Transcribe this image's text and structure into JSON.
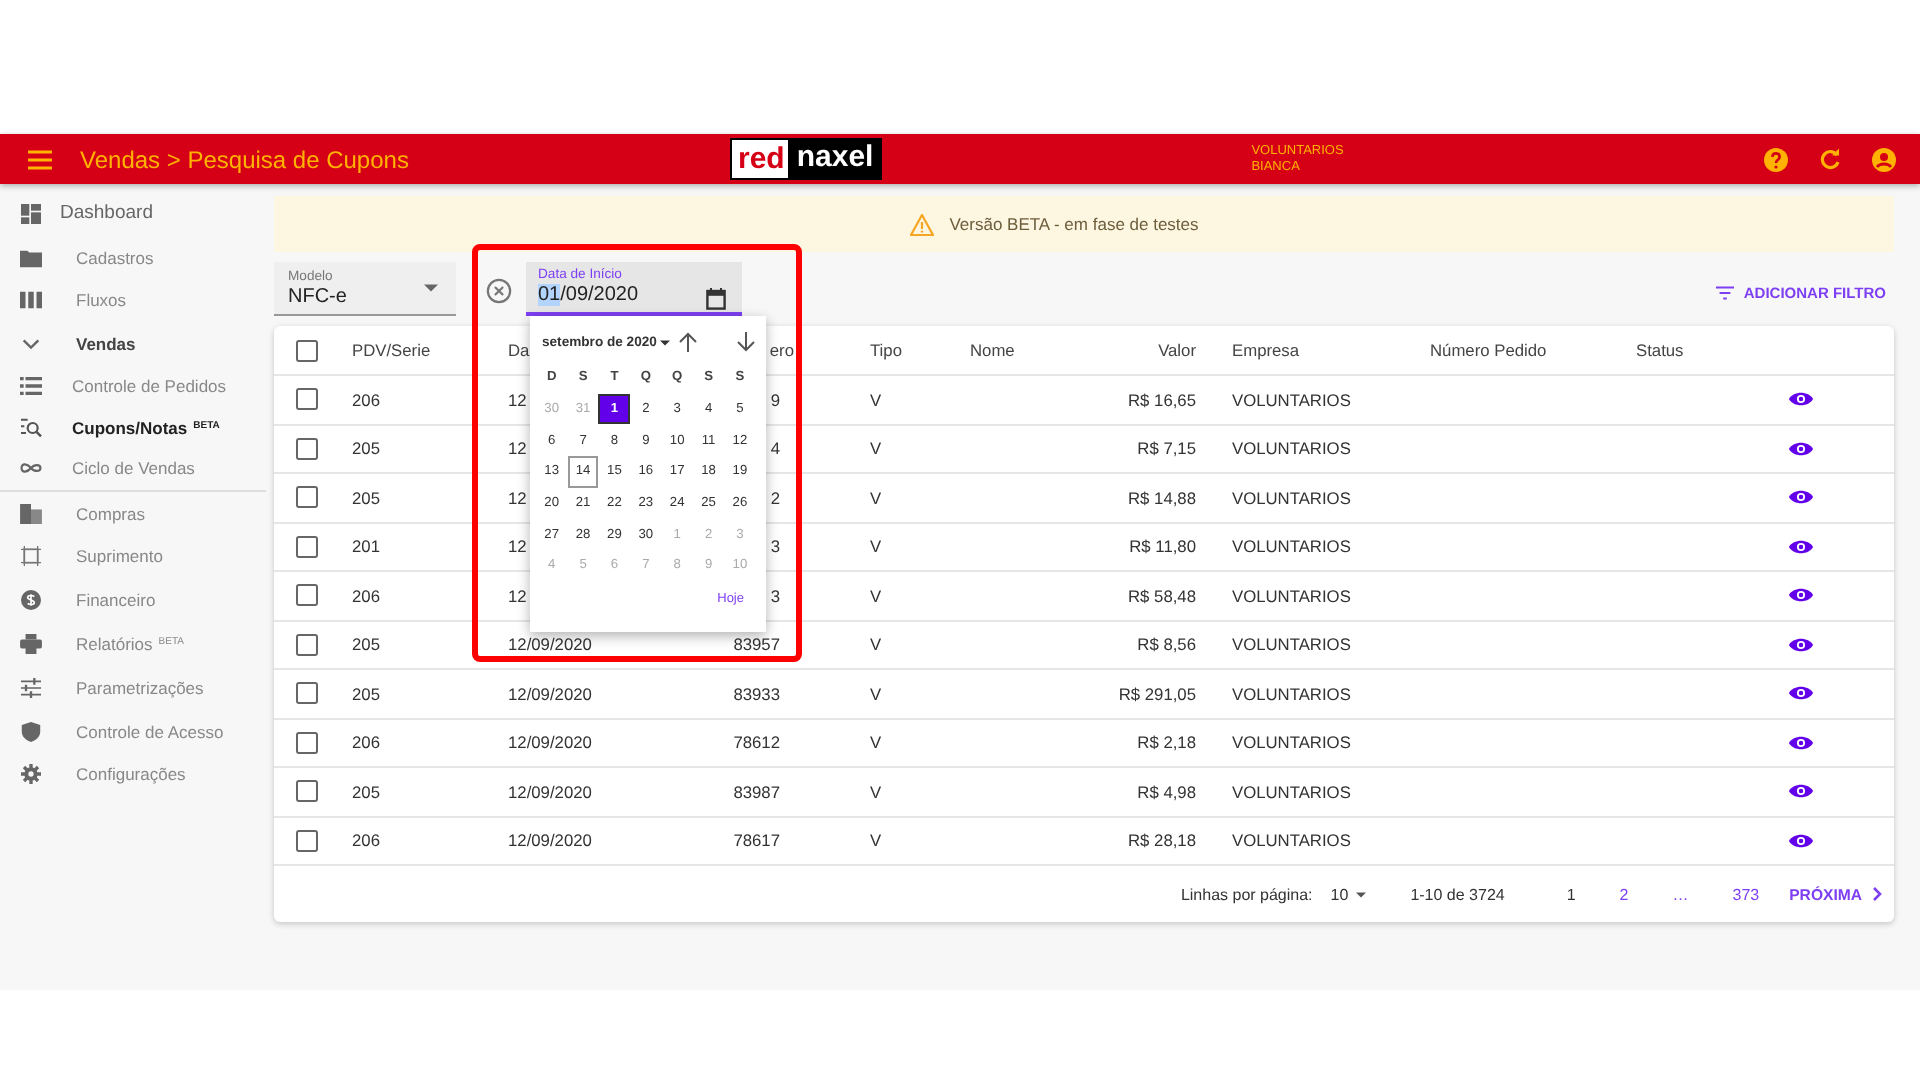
{
  "app_bar": {
    "title": "Vendas > Pesquisa de Cupons",
    "logo_left": "red",
    "logo_right": "naxel",
    "company": "VOLUNTARIOS",
    "user": "BIANCA"
  },
  "sidebar": {
    "items": [
      {
        "label": "Dashboard",
        "selected": false
      },
      {
        "label": "Cadastros",
        "selected": false
      },
      {
        "label": "Fluxos",
        "selected": false
      },
      {
        "label": "Vendas",
        "selected": false,
        "expanded": true,
        "children": [
          {
            "label": "Controle de Pedidos",
            "selected": false
          },
          {
            "label": "Cupons/Notas",
            "badge": "BETA",
            "selected": true
          },
          {
            "label": "Ciclo de Vendas",
            "selected": false
          }
        ]
      },
      {
        "label": "Compras",
        "selected": false
      },
      {
        "label": "Suprimento",
        "selected": false
      },
      {
        "label": "Financeiro",
        "selected": false
      },
      {
        "label": "Relatórios",
        "badge": "BETA",
        "selected": false
      },
      {
        "label": "Parametrizações",
        "selected": false
      },
      {
        "label": "Controle de Acesso",
        "selected": false
      },
      {
        "label": "Configurações",
        "selected": false
      }
    ]
  },
  "banner": {
    "text": "Versão BETA - em fase de testes"
  },
  "filters": {
    "model": {
      "label": "Modelo",
      "value": "NFC-e"
    },
    "start_date": {
      "label": "Data de Início",
      "value_selected": "01",
      "value_rest": "/09/2020"
    },
    "add_filter": "ADICIONAR FILTRO"
  },
  "date_picker": {
    "month": "setembro de 2020",
    "weekdays": [
      "D",
      "S",
      "T",
      "Q",
      "Q",
      "S",
      "S"
    ],
    "weeks": [
      [
        {
          "day": "30",
          "in_month": false,
          "selected": false,
          "today": false
        },
        {
          "day": "31",
          "in_month": false,
          "selected": false,
          "today": false
        },
        {
          "day": "1",
          "in_month": true,
          "selected": true,
          "today": false
        },
        {
          "day": "2",
          "in_month": true,
          "selected": false,
          "today": false
        },
        {
          "day": "3",
          "in_month": true,
          "selected": false,
          "today": false
        },
        {
          "day": "4",
          "in_month": true,
          "selected": false,
          "today": false
        },
        {
          "day": "5",
          "in_month": true,
          "selected": false,
          "today": false
        }
      ],
      [
        {
          "day": "6",
          "in_month": true,
          "selected": false,
          "today": false
        },
        {
          "day": "7",
          "in_month": true,
          "selected": false,
          "today": false
        },
        {
          "day": "8",
          "in_month": true,
          "selected": false,
          "today": false
        },
        {
          "day": "9",
          "in_month": true,
          "selected": false,
          "today": false
        },
        {
          "day": "10",
          "in_month": true,
          "selected": false,
          "today": false
        },
        {
          "day": "11",
          "in_month": true,
          "selected": false,
          "today": false
        },
        {
          "day": "12",
          "in_month": true,
          "selected": false,
          "today": false
        }
      ],
      [
        {
          "day": "13",
          "in_month": true,
          "selected": false,
          "today": false
        },
        {
          "day": "14",
          "in_month": true,
          "selected": false,
          "today": true
        },
        {
          "day": "15",
          "in_month": true,
          "selected": false,
          "today": false
        },
        {
          "day": "16",
          "in_month": true,
          "selected": false,
          "today": false
        },
        {
          "day": "17",
          "in_month": true,
          "selected": false,
          "today": false
        },
        {
          "day": "18",
          "in_month": true,
          "selected": false,
          "today": false
        },
        {
          "day": "19",
          "in_month": true,
          "selected": false,
          "today": false
        }
      ],
      [
        {
          "day": "20",
          "in_month": true,
          "selected": false,
          "today": false
        },
        {
          "day": "21",
          "in_month": true,
          "selected": false,
          "today": false
        },
        {
          "day": "22",
          "in_month": true,
          "selected": false,
          "today": false
        },
        {
          "day": "23",
          "in_month": true,
          "selected": false,
          "today": false
        },
        {
          "day": "24",
          "in_month": true,
          "selected": false,
          "today": false
        },
        {
          "day": "25",
          "in_month": true,
          "selected": false,
          "today": false
        },
        {
          "day": "26",
          "in_month": true,
          "selected": false,
          "today": false
        }
      ],
      [
        {
          "day": "27",
          "in_month": true,
          "selected": false,
          "today": false
        },
        {
          "day": "28",
          "in_month": true,
          "selected": false,
          "today": false
        },
        {
          "day": "29",
          "in_month": true,
          "selected": false,
          "today": false
        },
        {
          "day": "30",
          "in_month": true,
          "selected": false,
          "today": false
        },
        {
          "day": "1",
          "in_month": false,
          "selected": false,
          "today": false
        },
        {
          "day": "2",
          "in_month": false,
          "selected": false,
          "today": false
        },
        {
          "day": "3",
          "in_month": false,
          "selected": false,
          "today": false
        }
      ],
      [
        {
          "day": "4",
          "in_month": false,
          "selected": false,
          "today": false
        },
        {
          "day": "5",
          "in_month": false,
          "selected": false,
          "today": false
        },
        {
          "day": "6",
          "in_month": false,
          "selected": false,
          "today": false
        },
        {
          "day": "7",
          "in_month": false,
          "selected": false,
          "today": false
        },
        {
          "day": "8",
          "in_month": false,
          "selected": false,
          "today": false
        },
        {
          "day": "9",
          "in_month": false,
          "selected": false,
          "today": false
        },
        {
          "day": "10",
          "in_month": false,
          "selected": false,
          "today": false
        }
      ]
    ],
    "today_button": "Hoje"
  },
  "table": {
    "all_checked": false,
    "columns": [
      "PDV/Serie",
      "Da",
      "ero",
      "Tipo",
      "Nome",
      "Valor",
      "Empresa",
      "Número Pedido",
      "Status"
    ],
    "rows": [
      {
        "checked": false,
        "pdv": "206",
        "data": "12",
        "numero": "9",
        "tipo": "V",
        "valor": "R$ 16,65",
        "empresa": "VOLUNTARIOS"
      },
      {
        "checked": false,
        "pdv": "205",
        "data": "12",
        "numero": "4",
        "tipo": "V",
        "valor": "R$ 7,15",
        "empresa": "VOLUNTARIOS"
      },
      {
        "checked": false,
        "pdv": "205",
        "data": "12",
        "numero": "2",
        "tipo": "V",
        "valor": "R$ 14,88",
        "empresa": "VOLUNTARIOS"
      },
      {
        "checked": false,
        "pdv": "201",
        "data": "12",
        "numero": "3",
        "tipo": "V",
        "valor": "R$ 11,80",
        "empresa": "VOLUNTARIOS"
      },
      {
        "checked": false,
        "pdv": "206",
        "data": "12",
        "numero": "3",
        "tipo": "V",
        "valor": "R$ 58,48",
        "empresa": "VOLUNTARIOS"
      },
      {
        "checked": false,
        "pdv": "205",
        "data": "12/09/2020",
        "numero": "83957",
        "tipo": "V",
        "valor": "R$ 8,56",
        "empresa": "VOLUNTARIOS"
      },
      {
        "checked": false,
        "pdv": "205",
        "data": "12/09/2020",
        "numero": "83933",
        "tipo": "V",
        "valor": "R$ 291,05",
        "empresa": "VOLUNTARIOS"
      },
      {
        "checked": false,
        "pdv": "206",
        "data": "12/09/2020",
        "numero": "78612",
        "tipo": "V",
        "valor": "R$ 2,18",
        "empresa": "VOLUNTARIOS"
      },
      {
        "checked": false,
        "pdv": "205",
        "data": "12/09/2020",
        "numero": "83987",
        "tipo": "V",
        "valor": "R$ 4,98",
        "empresa": "VOLUNTARIOS"
      },
      {
        "checked": false,
        "pdv": "206",
        "data": "12/09/2020",
        "numero": "78617",
        "tipo": "V",
        "valor": "R$ 28,18",
        "empresa": "VOLUNTARIOS"
      }
    ]
  },
  "pagination": {
    "rows_label": "Linhas por página:",
    "rows_value": "10",
    "range": "1-10 de 3724",
    "pages": [
      {
        "label": "1",
        "selected": true
      },
      {
        "label": "2",
        "selected": false
      },
      {
        "label": "…",
        "selected": false
      },
      {
        "label": "373",
        "selected": false
      }
    ],
    "next": "PRÓXIMA"
  }
}
